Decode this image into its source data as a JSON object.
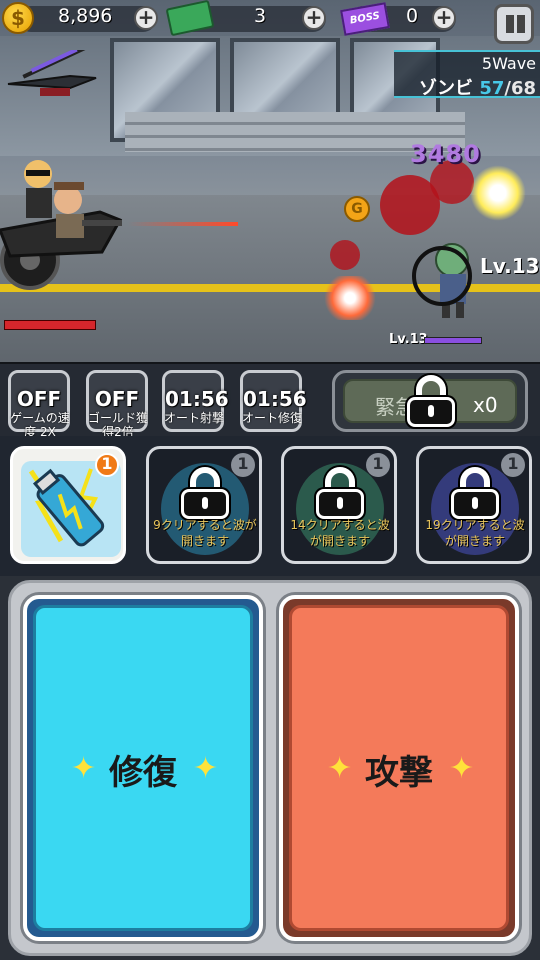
{
  "hud": {
    "gold": "8,896",
    "cash": "3",
    "boss_tickets": "0",
    "boss_ticket_label": "BOSS",
    "coin_symbol": "$"
  },
  "wave": {
    "label": "5Wave",
    "enemy_name": "ゾンビ",
    "current": "57",
    "total": "/68"
  },
  "battle": {
    "damage_number": "3480",
    "enemy_level": "Lv.13",
    "zombie_level": "Lv.13",
    "coin_symbol": "G"
  },
  "skills": [
    {
      "value": "OFF",
      "label": "ゲームの速度 2X"
    },
    {
      "value": "OFF",
      "label": "ゴールド獲得2倍"
    },
    {
      "value": "01:56",
      "label": "オート射撃"
    },
    {
      "value": "01:56",
      "label": "オート修復"
    }
  ],
  "emergency": {
    "label": "緊急",
    "count": "x0"
  },
  "items": [
    {
      "badge": "1",
      "desc": ""
    },
    {
      "badge": "1",
      "desc": "9クリアすると波が開きます"
    },
    {
      "badge": "1",
      "desc": "14クリアすると波が開きます"
    },
    {
      "badge": "1",
      "desc": "19クリアすると波が開きます"
    }
  ],
  "actions": {
    "repair": "修復",
    "attack": "攻撃",
    "sparkle": "✦"
  },
  "colors": {
    "repair": "#3ad8f2",
    "attack": "#f47a5a",
    "wave_accent": "#48c9e8"
  }
}
